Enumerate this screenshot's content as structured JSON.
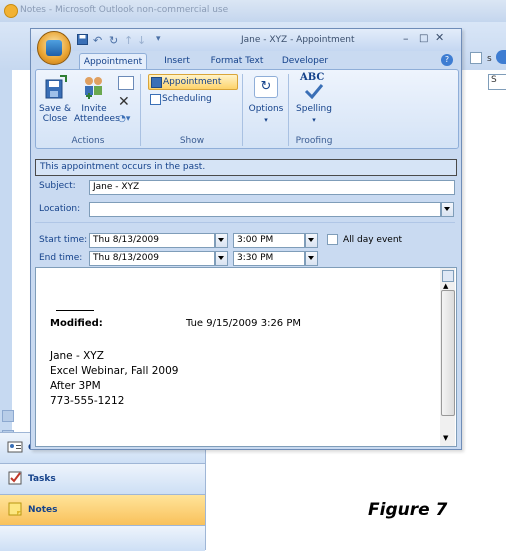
{
  "background_app": {
    "title": "Notes - Microsoft Outlook non-commercial use",
    "nav_items": [
      {
        "label": "Contacts",
        "icon": "contacts-icon"
      },
      {
        "label": "Tasks",
        "icon": "tasks-icon"
      },
      {
        "label": "Notes",
        "icon": "notes-icon"
      }
    ],
    "partial_text": "s",
    "partial_text_2": "S"
  },
  "appointment": {
    "title": "Jane - XYZ - Appointment",
    "tabs": [
      "Appointment",
      "Insert",
      "Format Text",
      "Developer"
    ],
    "ribbon": {
      "actions": {
        "save_close": "Save & Close",
        "invite_attendees": "Invite Attendees",
        "group_label": "Actions"
      },
      "show": {
        "appointment": "Appointment",
        "scheduling": "Scheduling",
        "group_label": "Show"
      },
      "options": {
        "label": "Options"
      },
      "proofing": {
        "spelling": "Spelling",
        "group_label": "Proofing"
      }
    },
    "info_bar": "This appointment occurs in the past.",
    "form": {
      "subject_label": "Subject:",
      "subject_value": "Jane - XYZ",
      "location_label": "Location:",
      "location_value": "",
      "start_label": "Start time:",
      "start_date": "Thu 8/13/2009",
      "start_time": "3:00 PM",
      "end_label": "End time:",
      "end_date": "Thu 8/13/2009",
      "end_time": "3:30 PM",
      "all_day_label": "All day event",
      "all_day_checked": false
    },
    "notes": {
      "modified_label": "Modified:",
      "modified_value": "Tue 9/15/2009 3:26 PM",
      "lines": [
        "Jane - XYZ",
        "Excel Webinar, Fall 2009",
        "After 3PM",
        "773-555-1212"
      ]
    }
  },
  "caption": "Figure 7",
  "colors": {
    "accent": "#15428b",
    "notes_nav": "#f9c15b",
    "ribbon_bg": "#d4e3f6"
  }
}
